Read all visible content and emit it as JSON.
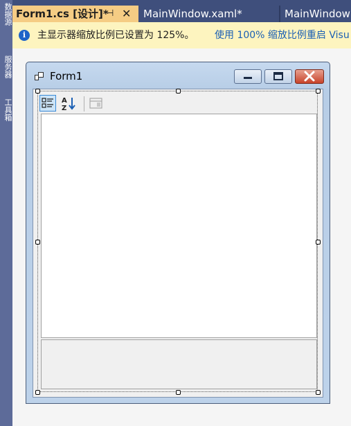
{
  "left_rail": {
    "labels": [
      "数据源",
      "服务器",
      "工具箱"
    ]
  },
  "tabs": [
    {
      "label": "Form1.cs [设计]*",
      "active": true
    },
    {
      "label": "MainWindow.xaml*",
      "active": false
    },
    {
      "label": "MainWindow",
      "active": false
    }
  ],
  "tab_icons": {
    "pin": "pin-icon",
    "close": "close-icon"
  },
  "infobar": {
    "icon": "info-icon",
    "icon_glyph": "i",
    "message": "主显示器缩放比例已设置为 125%。",
    "link": "使用 100% 缩放比例重启 Visu"
  },
  "form": {
    "title": "Form1",
    "app_icon": "form-app-icon",
    "buttons": [
      "minimize-icon",
      "maximize-icon",
      "close-icon"
    ]
  },
  "property_grid": {
    "toolbar": [
      {
        "icon": "categorized-icon",
        "selected": true
      },
      {
        "icon": "alphabetical-icon",
        "selected": false
      },
      {
        "icon": "property-pages-icon",
        "selected": false
      }
    ]
  },
  "colors": {
    "rail": "#5d6b99",
    "tabbar": "#3f4f7c",
    "active_tab": "#f5cc84",
    "infobar": "#fdf4bf",
    "link": "#1a5fb4"
  }
}
